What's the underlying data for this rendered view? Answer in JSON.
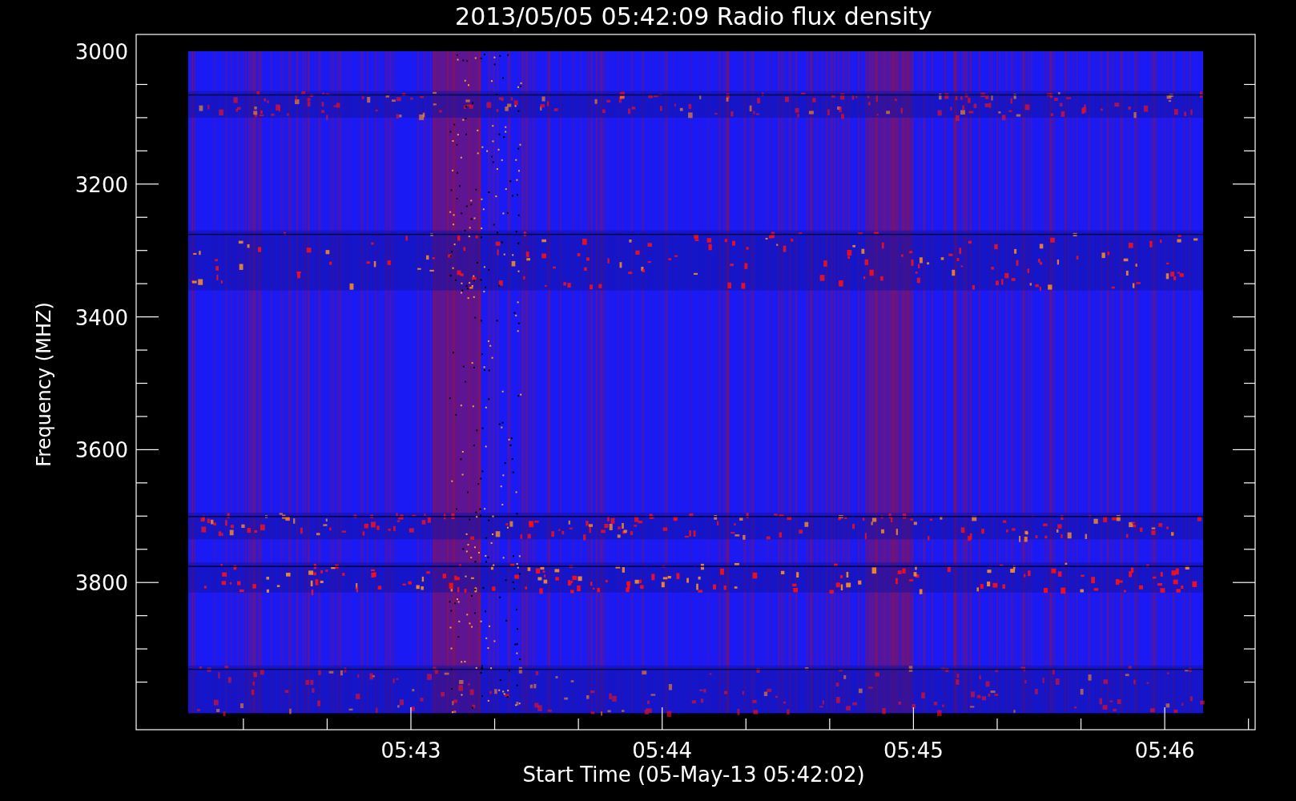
{
  "title": "2013/05/05 05:42:09 Radio flux density",
  "y_axis": {
    "label": "Frequency (MHZ)",
    "ticks": [
      "3000",
      "3200",
      "3400",
      "3600",
      "3800"
    ]
  },
  "x_axis": {
    "label": "Start Time (05-May-13 05:42:02)",
    "ticks": [
      "05:43",
      "05:44",
      "05:45",
      "05:46"
    ]
  }
}
